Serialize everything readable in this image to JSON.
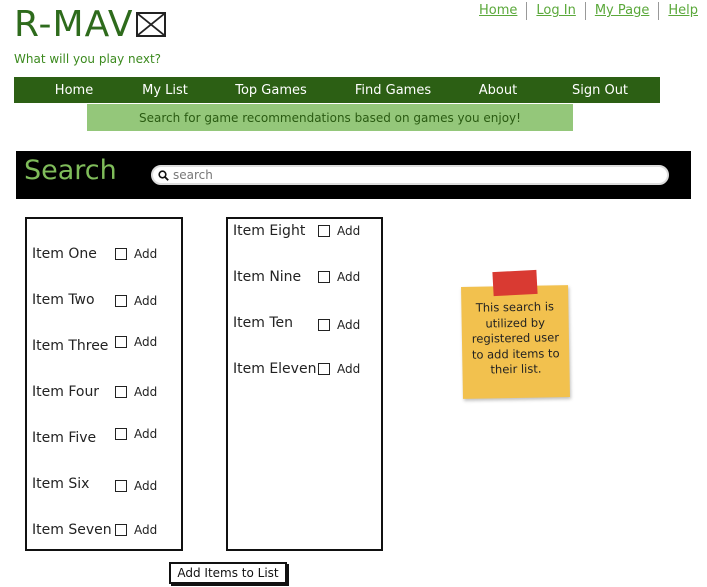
{
  "logo": {
    "text": "R-MAV",
    "image_icon": "broken-image-icon"
  },
  "tagline": "What will you play next?",
  "top_links": [
    "Home",
    "Log In",
    "My Page",
    "Help"
  ],
  "nav": [
    "Home",
    "My List",
    "Top Games",
    "Find Games",
    "About",
    "Sign Out"
  ],
  "subheader": "Search for game recommendations based on games you enjoy!",
  "search": {
    "title": "Search",
    "placeholder": "search",
    "value": "",
    "icon": "search-icon"
  },
  "list_left": [
    {
      "label": "Item One",
      "add": "Add",
      "checked": false
    },
    {
      "label": "Item Two",
      "add": "Add",
      "checked": false
    },
    {
      "label": "Item Three",
      "add": "Add",
      "checked": false
    },
    {
      "label": "Item Four",
      "add": "Add",
      "checked": false
    },
    {
      "label": "Item Five",
      "add": "Add",
      "checked": false
    },
    {
      "label": "Item Six",
      "add": "Add",
      "checked": false
    },
    {
      "label": "Item Seven",
      "add": "Add",
      "checked": false
    }
  ],
  "list_right": [
    {
      "label": "Item Eight",
      "add": "Add",
      "checked": false
    },
    {
      "label": "Item Nine",
      "add": "Add",
      "checked": false
    },
    {
      "label": "Item Ten",
      "add": "Add",
      "checked": false
    },
    {
      "label": "Item Eleven",
      "add": "Add",
      "checked": false
    }
  ],
  "sticky_note": "This search is utilized by registered user to add items to their list.",
  "add_button": "Add Items to List",
  "colors": {
    "brand_green": "#2e6b1c",
    "nav_bg": "#2c5f14",
    "subbar_bg": "#94c77a",
    "search_title": "#7fbc5a",
    "note_yellow": "#f2c14e",
    "note_tape": "#d93a32",
    "link_green": "#5aa83a"
  }
}
